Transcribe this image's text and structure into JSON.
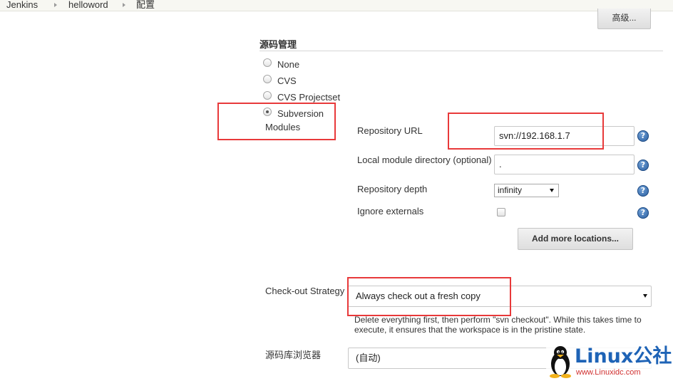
{
  "breadcrumb": [
    "Jenkins",
    "helloword",
    "配置"
  ],
  "advanced_button": "高级...",
  "scm": {
    "title": "源码管理",
    "options": [
      "None",
      "CVS",
      "CVS Projectset",
      "Subversion"
    ],
    "selected": "Subversion",
    "modules_label": "Modules"
  },
  "svn": {
    "repo_url_label": "Repository URL",
    "repo_url_value": "svn://192.168.1.7",
    "local_dir_label": "Local module directory (optional)",
    "local_dir_value": ".",
    "depth_label": "Repository depth",
    "depth_value": "infinity",
    "ignore_label": "Ignore externals",
    "ignore_checked": false,
    "add_locations_button": "Add more locations..."
  },
  "checkout": {
    "label": "Check-out Strategy",
    "value": "Always check out a fresh copy",
    "description": "Delete everything first, then perform \"svn checkout\". While this takes time to execute, it ensures that the workspace is in the pristine state."
  },
  "browser": {
    "label": "源码库浏览器",
    "value": "(自动)"
  },
  "help_icon_glyph": "?",
  "watermark": {
    "brand": "Linux公社",
    "url": "www.Linuxidc.com"
  },
  "colors": {
    "highlight": "#e8393a",
    "help_icon": "#2a5ea0"
  }
}
